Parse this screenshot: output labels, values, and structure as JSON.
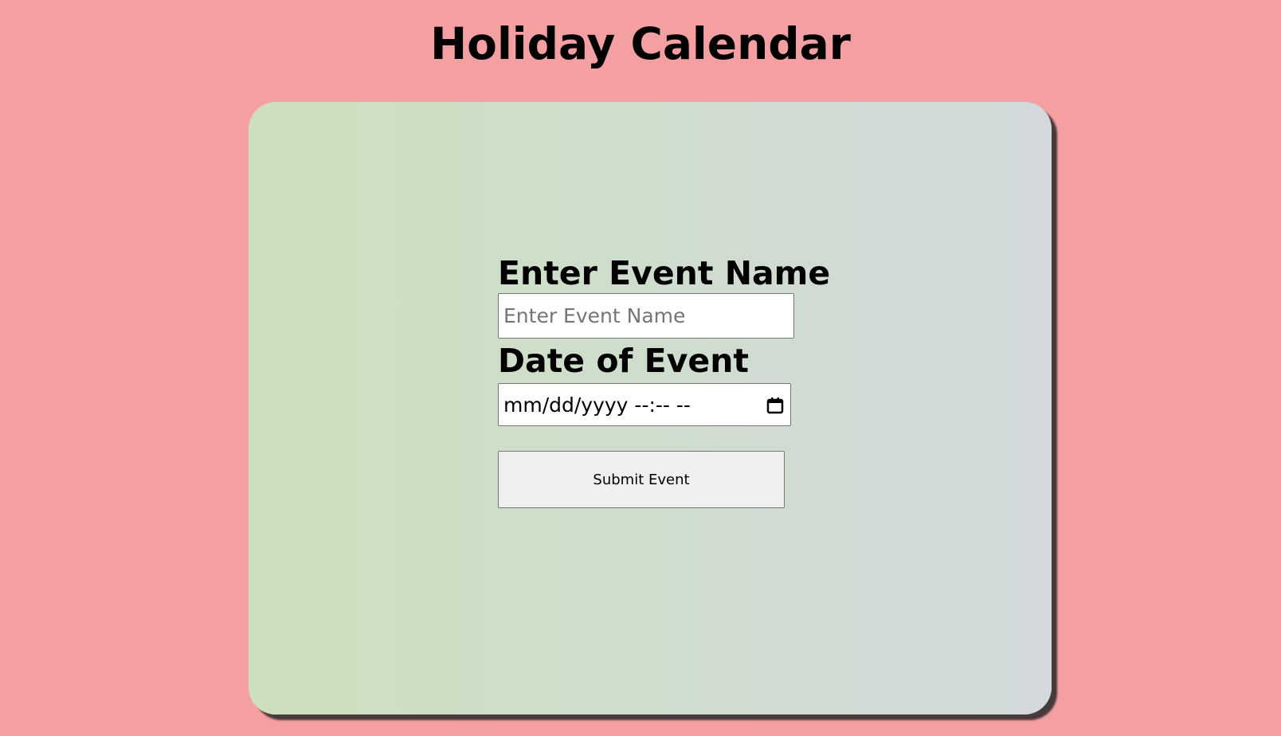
{
  "page": {
    "title": "Holiday Calendar"
  },
  "form": {
    "event_name_label": "Enter Event Name",
    "event_name_placeholder": "Enter Event Name",
    "event_name_value": "",
    "date_label": "Date of Event",
    "date_placeholder": "mm/dd/yyyy --:-- --",
    "submit_label": "Submit Event"
  },
  "icons": {
    "date_picker": "calendar-icon"
  },
  "colors": {
    "page_background": "#f4a0a2",
    "card_gradient_start": "#cddfbd",
    "card_gradient_end": "#d3d9dc",
    "button_background": "#efefef"
  }
}
